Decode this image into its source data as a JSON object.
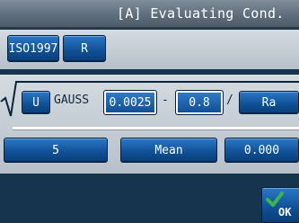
{
  "title": "[A] Evaluating Cond.",
  "standard": {
    "value": "ISO1997",
    "param": "R"
  },
  "formula": {
    "root_param": "U",
    "filter_label": "GAUSS",
    "lower_value": "0.0025",
    "minus": "-",
    "upper_value": "0.8",
    "slash": "/",
    "result_param": "Ra"
  },
  "result_row": {
    "count": "5",
    "method": "Mean",
    "value": "0.000"
  },
  "ok_label": "OK",
  "colors": {
    "button_blue": "#0f4f94",
    "panel": "#c7cfd6",
    "background": "#16344e",
    "ok_check": "#39b54a"
  }
}
